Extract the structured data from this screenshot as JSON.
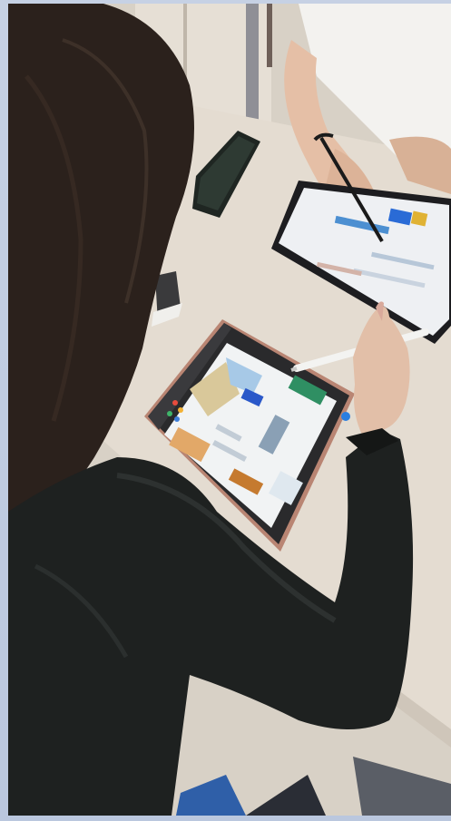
{
  "image": {
    "border_color": "#c6d1e4",
    "palette": {
      "desk": "#e3dbd0",
      "hair": "#2b211c",
      "sweater": "#1e2120",
      "skin": "#e2bfa8",
      "tablet_frame": "#2a2a2c",
      "tablet_case": "#b98573",
      "screen": "#f1f3f4",
      "stylus": "#f3f3f1"
    },
    "icons": [
      "apple-pencil",
      "smartphone",
      "tablet"
    ]
  }
}
